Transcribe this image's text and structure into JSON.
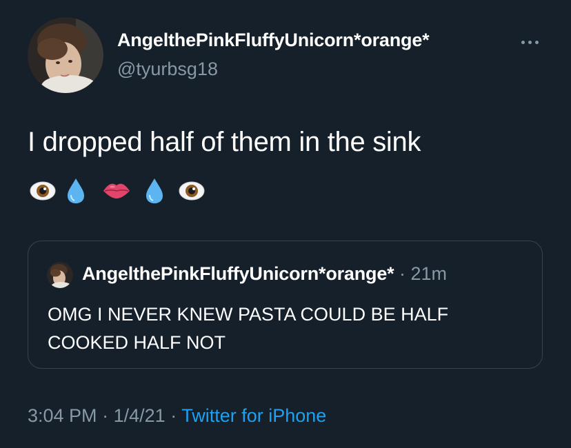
{
  "author": {
    "display_name": "AngelthePinkFluffyUnicorn*orange*",
    "handle": "@tyurbsg18"
  },
  "tweet": {
    "text": "I dropped half of them in the sink",
    "emojis": [
      "eye",
      "droplet",
      "lips",
      "droplet",
      "eye"
    ]
  },
  "quote": {
    "display_name": "AngelthePinkFluffyUnicorn*orange*",
    "separator": "·",
    "time": "21m",
    "text": "OMG I NEVER KNEW PASTA COULD BE HALF COOKED HALF NOT"
  },
  "meta": {
    "time": "3:04 PM",
    "sep1": "·",
    "date": "1/4/21",
    "sep2": "·",
    "source": "Twitter for iPhone"
  },
  "colors": {
    "background": "#15202b",
    "text": "#ffffff",
    "secondary": "#8899a6",
    "link": "#1da1f2",
    "border": "#38444d"
  },
  "icons": {
    "more": "more-horizontal-icon"
  }
}
